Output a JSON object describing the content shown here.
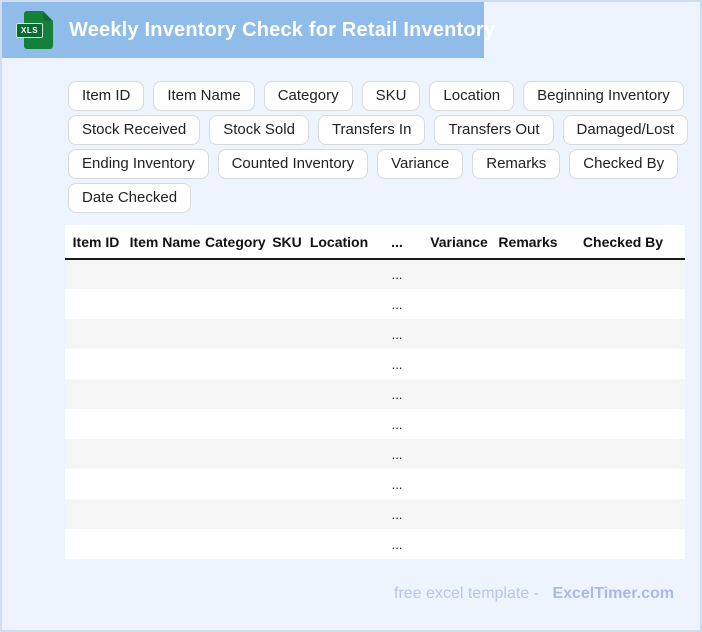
{
  "header": {
    "title": "Weekly Inventory Check for Retail Inventory",
    "file_icon_label": "XLS"
  },
  "colors": {
    "header_bar": "#8fbce9",
    "page_background": "#edf4fd",
    "icon_green": "#15803c",
    "icon_label_green": "#0a6b31",
    "chip_border": "#d6dade",
    "zebra_row": "#f5f5f6",
    "table_header_rule": "#1a1a1a",
    "footer_text": "#b7c5ee",
    "footer_brand": "#a9b9e8"
  },
  "chips": {
    "rows": [
      [
        "Item ID",
        "Item Name",
        "Category",
        "SKU",
        "Location",
        "Beginning Inventory"
      ],
      [
        "Stock Received",
        "Stock Sold",
        "Transfers In",
        "Transfers Out",
        "Damaged/Lost"
      ],
      [
        "Ending Inventory",
        "Counted Inventory",
        "Variance",
        "Remarks",
        "Checked By"
      ],
      [
        "Date Checked"
      ]
    ]
  },
  "table": {
    "columns": [
      "Item ID",
      "Item Name",
      "Category",
      "SKU",
      "Location",
      "...",
      "Variance",
      "Remarks",
      "Checked By"
    ],
    "rows": [
      [
        "",
        "",
        "",
        "",
        "",
        "...",
        "",
        "",
        ""
      ],
      [
        "",
        "",
        "",
        "",
        "",
        "...",
        "",
        "",
        ""
      ],
      [
        "",
        "",
        "",
        "",
        "",
        "...",
        "",
        "",
        ""
      ],
      [
        "",
        "",
        "",
        "",
        "",
        "...",
        "",
        "",
        ""
      ],
      [
        "",
        "",
        "",
        "",
        "",
        "...",
        "",
        "",
        ""
      ],
      [
        "",
        "",
        "",
        "",
        "",
        "...",
        "",
        "",
        ""
      ],
      [
        "",
        "",
        "",
        "",
        "",
        "...",
        "",
        "",
        ""
      ],
      [
        "",
        "",
        "",
        "",
        "",
        "...",
        "",
        "",
        ""
      ],
      [
        "",
        "",
        "",
        "",
        "",
        "...",
        "",
        "",
        ""
      ],
      [
        "",
        "",
        "",
        "",
        "",
        "...",
        "",
        "",
        ""
      ]
    ]
  },
  "footer": {
    "text": "free excel template -",
    "brand": "ExcelTimer.com"
  }
}
